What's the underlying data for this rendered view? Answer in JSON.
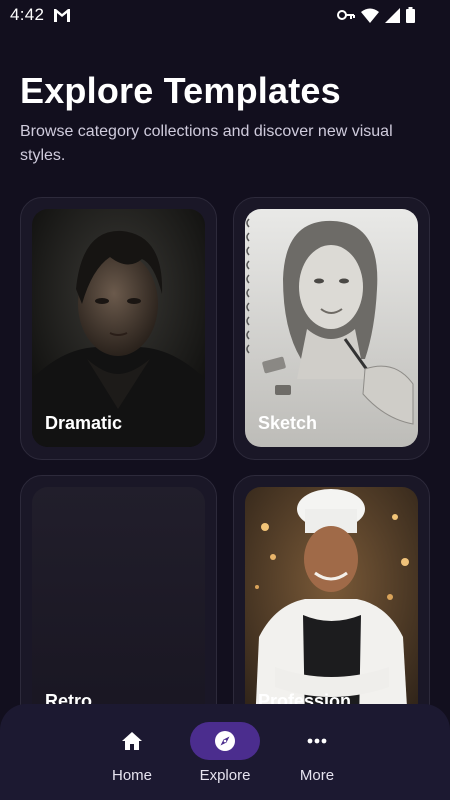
{
  "status_bar": {
    "time": "4:42",
    "icons": [
      "gmail-icon",
      "vpn-key-icon",
      "wifi-icon",
      "signal-icon",
      "battery-icon"
    ]
  },
  "header": {
    "title": "Explore Templates",
    "subtitle": "Browse category collections and discover new visual styles."
  },
  "cards": [
    {
      "label": "Dramatic"
    },
    {
      "label": "Sketch"
    },
    {
      "label": "Retro"
    },
    {
      "label": "Profession"
    }
  ],
  "bottom_nav": {
    "items": [
      {
        "label": "Home",
        "icon": "home-icon",
        "active": false
      },
      {
        "label": "Explore",
        "icon": "compass-icon",
        "active": true
      },
      {
        "label": "More",
        "icon": "more-icon",
        "active": false
      }
    ]
  },
  "colors": {
    "background": "#120f1e",
    "card": "#1a1727",
    "nav_bar": "#1c1931",
    "accent": "#4b2d8e"
  }
}
